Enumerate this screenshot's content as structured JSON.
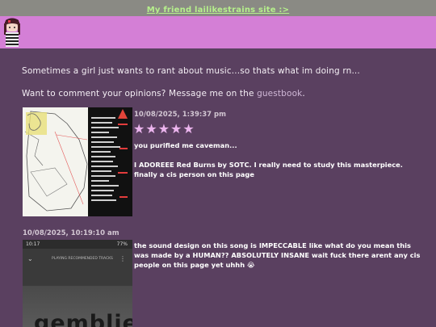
{
  "topbar": {
    "link": "My friend lailikestrains site :>"
  },
  "intro": {
    "line1": "Sometimes a girl just wants to rant about music...so thats what im doing rn...",
    "line2_prefix": "Want to comment your opinions? Message me on the ",
    "line2_link": "guestbook",
    "line2_suffix": "."
  },
  "entries": [
    {
      "date": "10/08/2025, 1:39:37 pm",
      "stars": "★★★★★",
      "line1": "you purified me caveman...",
      "body": "I ADOREEE Red Burns by SOTC. I really need to study this masterpiece. finally a cis person on this page"
    },
    {
      "date": "10/08/2025, 10:19:10 am",
      "body": "the sound design on this song is IMPECCABLE like what do you mean this was made by a HUMAN?? ABSOLUTELY INSANE wait fuck there arent any cis people on this page yet uhhh 😭",
      "phone": {
        "status_time": "10:17",
        "status_right": "77%",
        "playing_from": "PLAYING RECOMMENDED TRACKS",
        "big_text": "gemblie"
      }
    }
  ],
  "colors": {
    "background": "#5a4060",
    "header": "#d47fd6",
    "topbar": "#8a8a84",
    "link": "#b6f08c",
    "stars": "#ecb5ee"
  }
}
